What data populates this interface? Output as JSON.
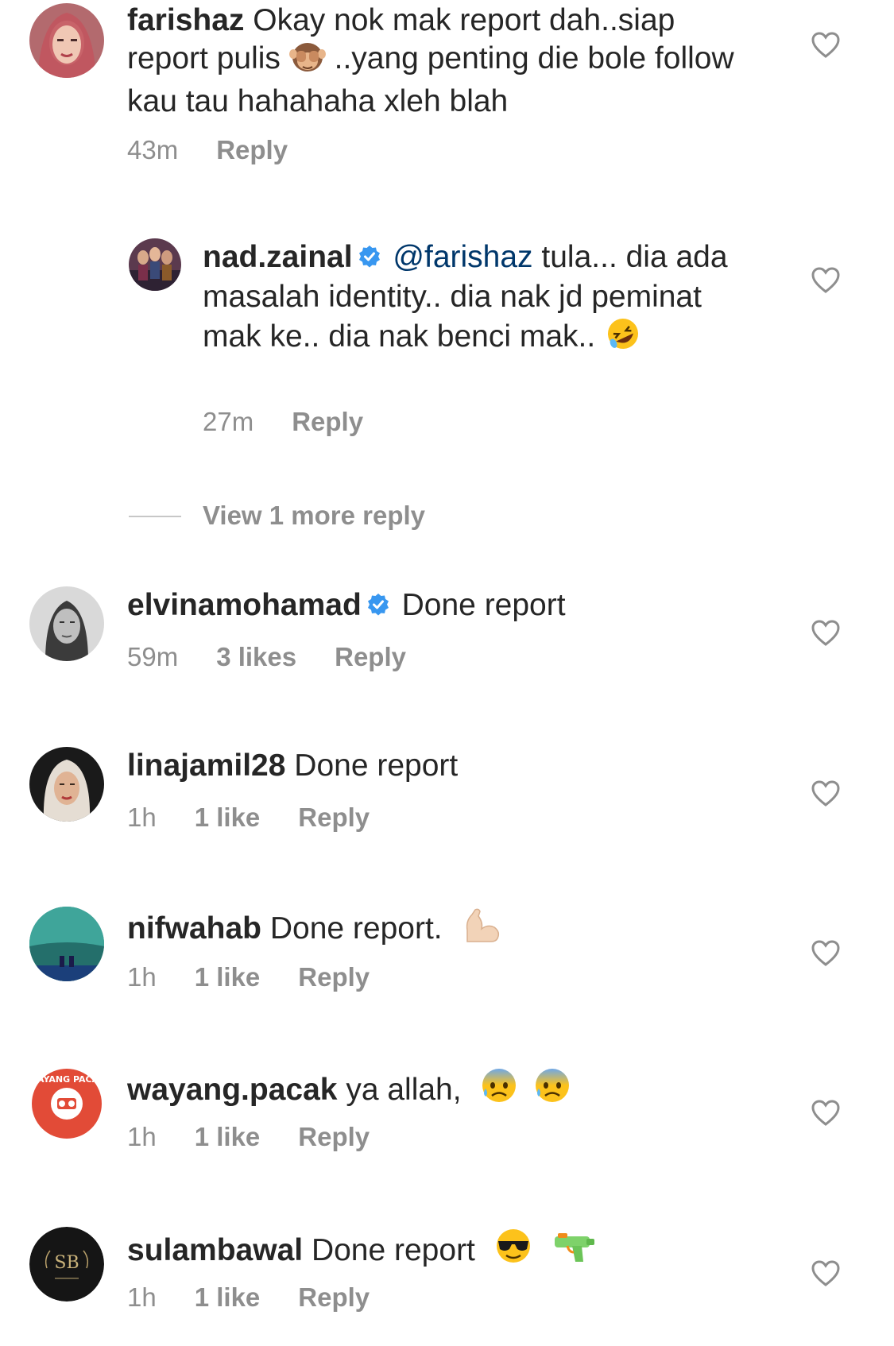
{
  "comments": [
    {
      "username": "farishaz",
      "text_parts": [
        "Okay nok mak report dah..siap report pulis",
        "..yang penting die bole follow kau tau hahahaha xleh blah"
      ],
      "time": "43m",
      "reply": "Reply"
    },
    {
      "username": "nad.zainal",
      "verified": true,
      "mention": "@farishaz",
      "text": "tula... dia ada masalah identity.. dia nak jd peminat mak ke.. dia nak benci mak..",
      "time": "27m",
      "reply": "Reply"
    },
    {
      "username": "elvinamohamad",
      "verified": true,
      "text": "Done report",
      "time": "59m",
      "likes": "3 likes",
      "reply": "Reply"
    },
    {
      "username": "linajamil28",
      "text": "Done report",
      "time": "1h",
      "likes": "1 like",
      "reply": "Reply"
    },
    {
      "username": "nifwahab",
      "text": "Done report.",
      "time": "1h",
      "likes": "1 like",
      "reply": "Reply"
    },
    {
      "username": "wayang.pacak",
      "text": "ya allah,",
      "time": "1h",
      "likes": "1 like",
      "reply": "Reply"
    },
    {
      "username": "sulambawal",
      "text": "Done report",
      "time": "1h",
      "likes": "1 like",
      "reply": "Reply"
    }
  ],
  "view_more_replies": "View 1 more reply",
  "avatar_logos": {
    "wayang_pacak": "WAYANG PACAK",
    "sulambawal": "SB"
  },
  "colors": {
    "username": "#262626",
    "meta": "#8e8e8e",
    "mention": "#00376b",
    "verified": "#3897f0"
  },
  "icons": [
    "heart-icon",
    "verified-badge-icon",
    "see-no-evil-monkey-emoji",
    "rolling-laughing-emoji",
    "flexed-biceps-emoji",
    "anxious-sweat-face-emoji",
    "sunglasses-face-emoji",
    "water-pistol-emoji"
  ]
}
